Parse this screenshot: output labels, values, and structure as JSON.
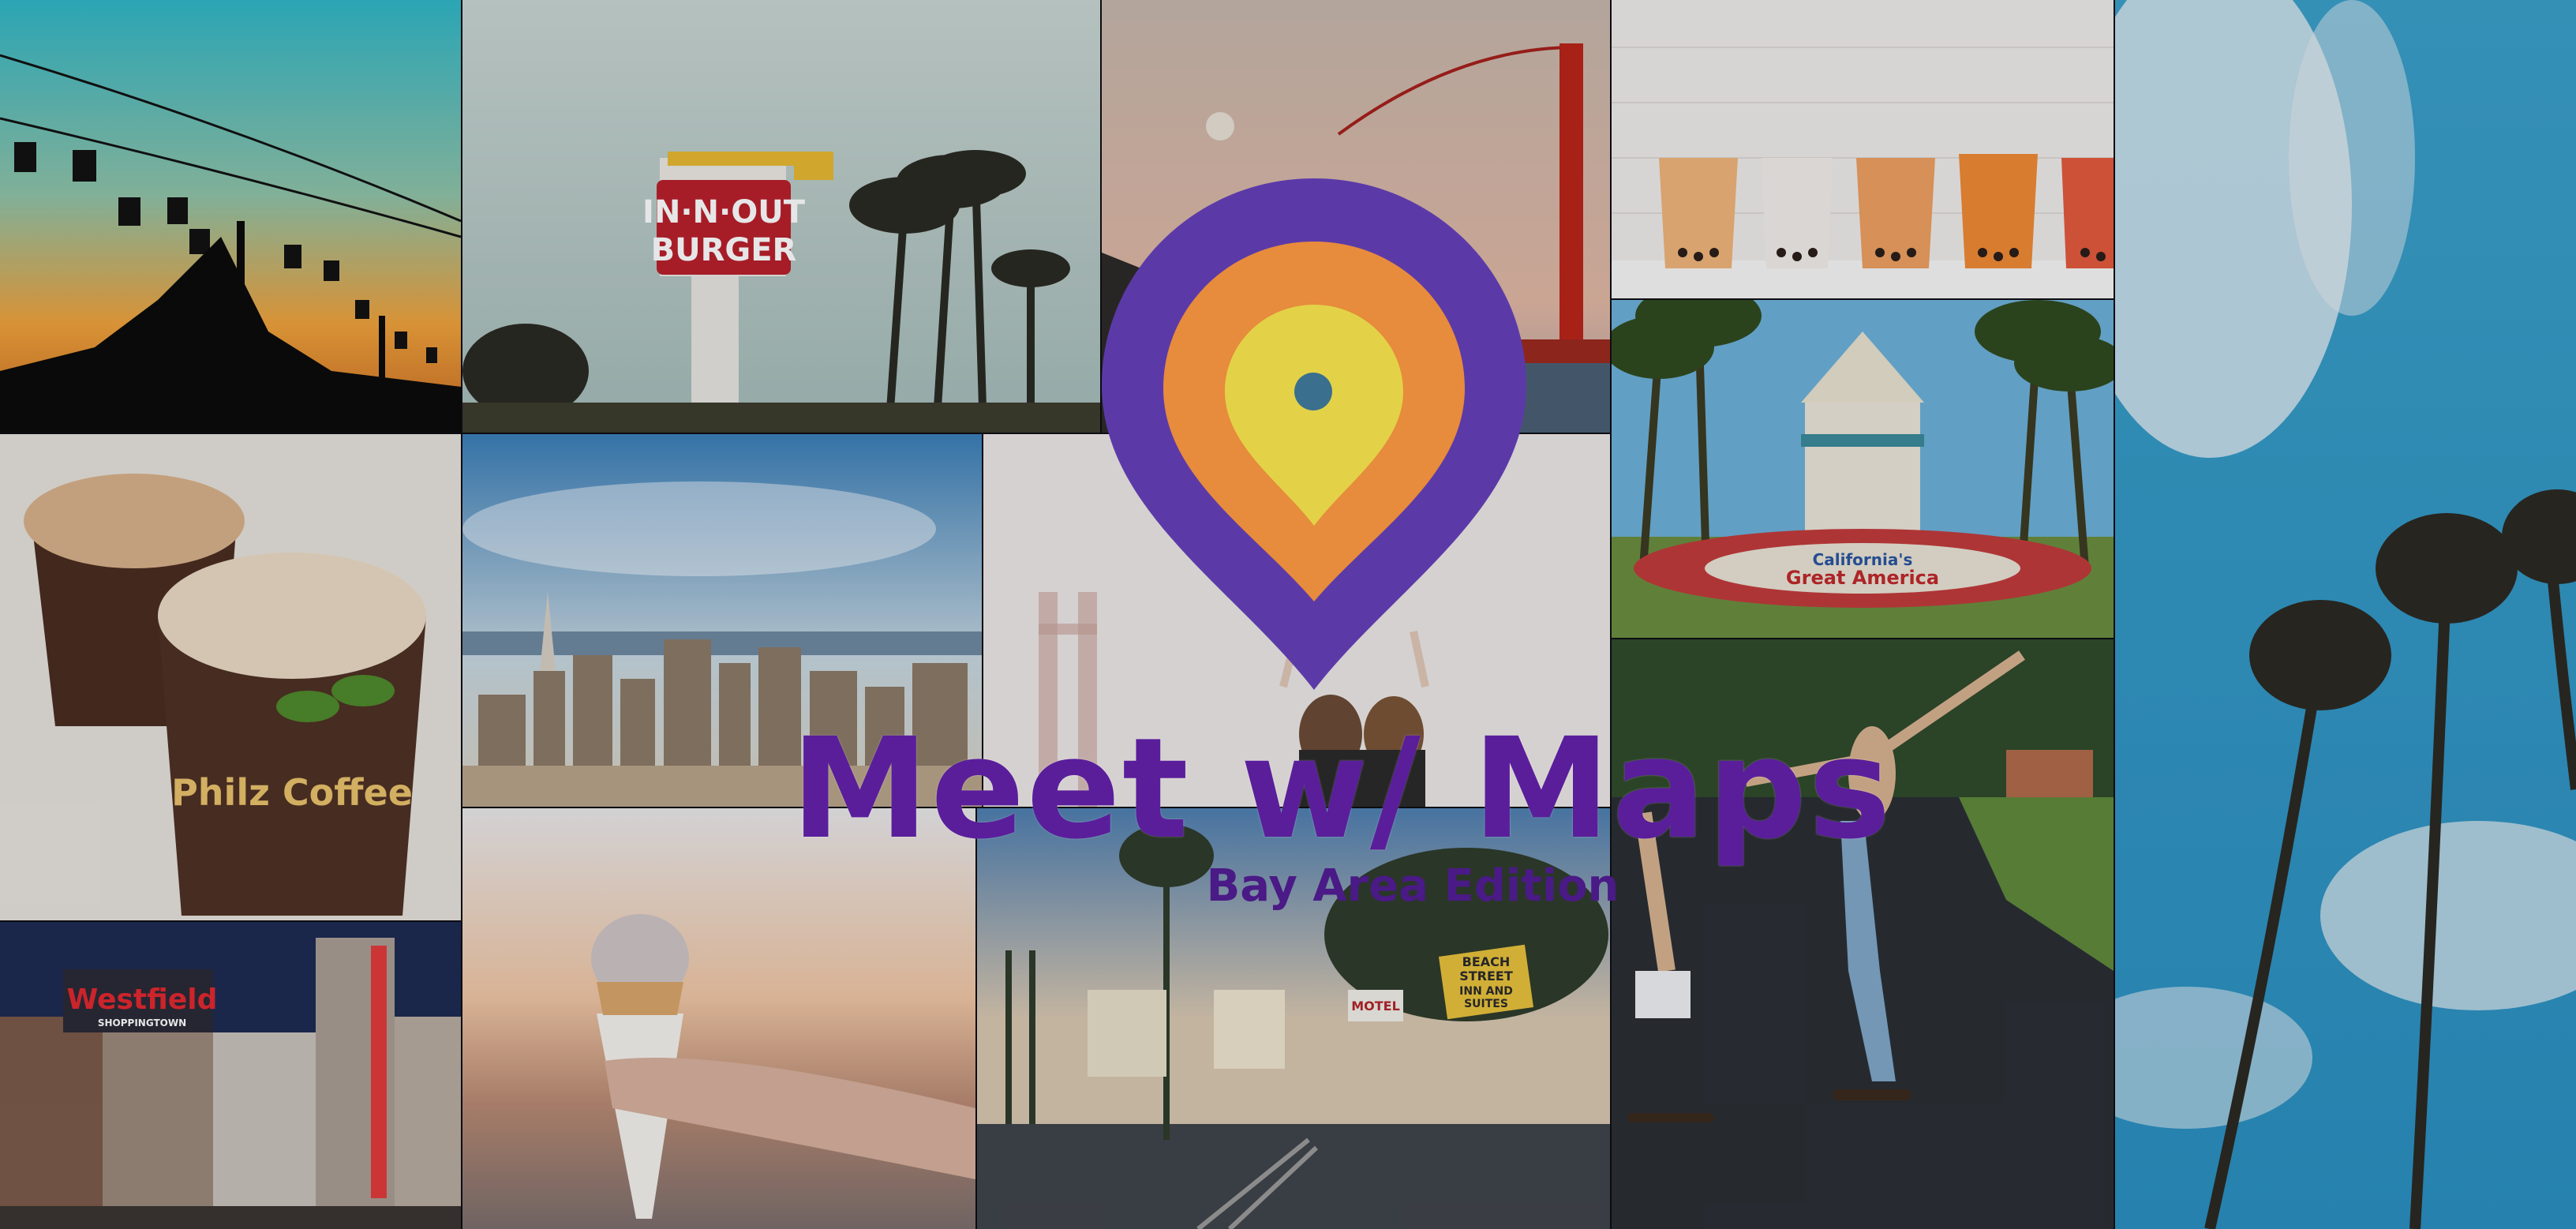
{
  "title": "Meet w/ Maps",
  "subtitle": "Bay Area Edition",
  "logo": {
    "outer_color": "#5b3aa8",
    "middle_color": "#e78b3c",
    "inner_color": "#e3d247"
  },
  "photos": {
    "innout_sign": {
      "line1": "IN·N·OUT",
      "line2": "BURGER"
    },
    "great_america_sign": {
      "line1": "California's",
      "line2": "Great America"
    },
    "coffee_cup_brand": "Philz Coffee",
    "westfield_sign": "Westfield",
    "westfield_sub": "SHOPPINGTOWN",
    "hotel_sign": "MOTEL",
    "beach_sign": {
      "line1": "BEACH",
      "line2": "STREET",
      "line3": "INN AND",
      "line4": "SUITES"
    }
  }
}
